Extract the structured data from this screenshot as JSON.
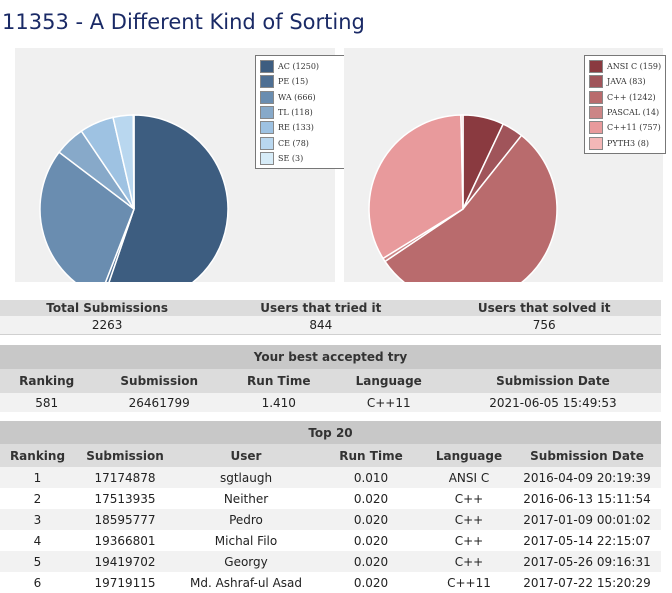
{
  "problem_title": "11353 - A Different Kind of Sorting",
  "chart_data": [
    {
      "type": "pie",
      "categories": [
        "AC",
        "PE",
        "WA",
        "TL",
        "RE",
        "CE",
        "SE"
      ],
      "values": [
        1250,
        15,
        666,
        118,
        133,
        78,
        3
      ],
      "legend_labels": [
        "AC (1250)",
        "PE (15)",
        "WA (666)",
        "TL (118)",
        "RE (133)",
        "CE (78)",
        "SE (3)"
      ],
      "colors": [
        "#3d5d80",
        "#4e6f93",
        "#6a8db0",
        "#87a9c9",
        "#9ec2e2",
        "#b9d7ef",
        "#d7ecf8"
      ],
      "legend": "right"
    },
    {
      "type": "pie",
      "categories": [
        "ANSI C",
        "JAVA",
        "C++",
        "PASCAL",
        "C++11",
        "PYTH3"
      ],
      "values": [
        159,
        83,
        1242,
        14,
        757,
        8
      ],
      "legend_labels": [
        "ANSI C (159)",
        "JAVA (83)",
        "C++ (1242)",
        "PASCAL (14)",
        "C++11 (757)",
        "PYTH3 (8)"
      ],
      "colors": [
        "#8a3a40",
        "#a0545a",
        "#b96b6d",
        "#cc8586",
        "#e89a9c",
        "#f4b7b7"
      ],
      "legend": "right"
    }
  ],
  "stats": {
    "headers": [
      "Total Submissions",
      "Users that tried it",
      "Users that solved it"
    ],
    "values": [
      "2263",
      "844",
      "756"
    ]
  },
  "best": {
    "caption": "Your best accepted try",
    "headers": [
      "Ranking",
      "Submission",
      "Run Time",
      "Language",
      "Submission Date"
    ],
    "row": [
      "581",
      "26461799",
      "1.410",
      "C++11",
      "2021-06-05 15:49:53"
    ]
  },
  "top20": {
    "caption": "Top 20",
    "headers": [
      "Ranking",
      "Submission",
      "User",
      "Run Time",
      "Language",
      "Submission Date"
    ],
    "rows": [
      [
        "1",
        "17174878",
        "sgtlaugh",
        "0.010",
        "ANSI C",
        "2016-04-09 20:19:39"
      ],
      [
        "2",
        "17513935",
        "Neither",
        "0.020",
        "C++",
        "2016-06-13 15:11:54"
      ],
      [
        "3",
        "18595777",
        "Pedro",
        "0.020",
        "C++",
        "2017-01-09 00:01:02"
      ],
      [
        "4",
        "19366801",
        "Michal Filo",
        "0.020",
        "C++",
        "2017-05-14 22:15:07"
      ],
      [
        "5",
        "19419702",
        "Georgy",
        "0.020",
        "C++",
        "2017-05-26 09:16:31"
      ],
      [
        "6",
        "19719115",
        "Md. Ashraf-ul Asad",
        "0.020",
        "C++11",
        "2017-07-22 15:20:29"
      ]
    ]
  }
}
